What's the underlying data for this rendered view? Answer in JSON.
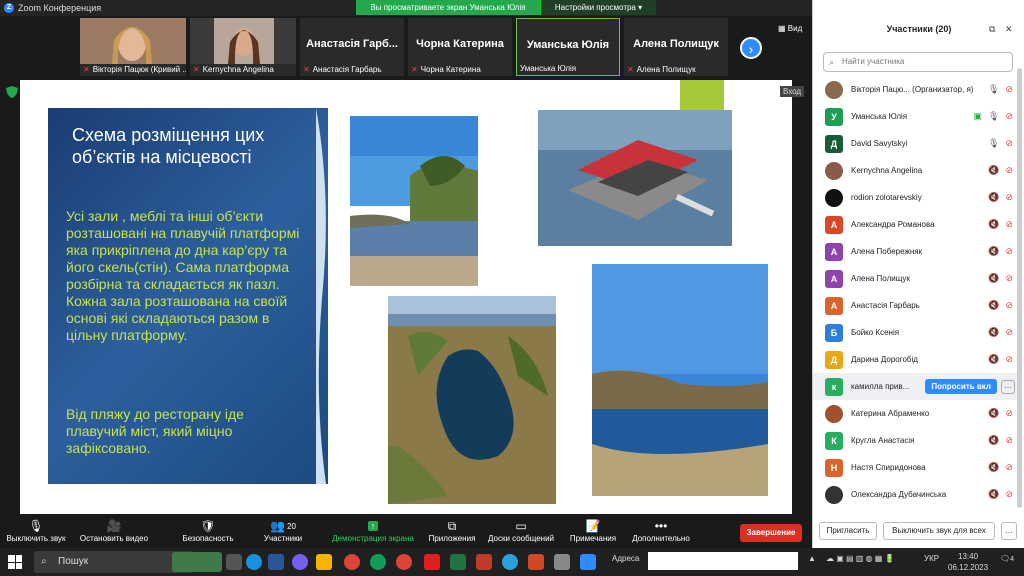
{
  "window": {
    "title": "Zoom Конференция",
    "share_banner": "Вы просматриваете экран Уманська Юлія",
    "view_settings": "Настройки просмотра"
  },
  "thumbnails": [
    {
      "label": "Вікторія Пацюк (Кривий ...",
      "muted": true,
      "video": true
    },
    {
      "label": "Kernychna Angelina",
      "muted": true,
      "video": true
    },
    {
      "name": "Анастасія Гарб...",
      "label": "Анастасія Гарбарь",
      "muted": true
    },
    {
      "name": "Чорна Катерина",
      "label": "Чорна Катерина",
      "muted": true
    },
    {
      "name": "Уманська Юлія",
      "label": "Уманська Юлія",
      "muted": false
    },
    {
      "name": "Алена Полищук",
      "label": "Алена Полищук",
      "muted": true
    }
  ],
  "view_label": "Вид",
  "exit_label": "Вход",
  "slide": {
    "title": "Схема розміщення цих об’єктів на місцевості",
    "body1": "Усі зали , меблі та інші об’єкти розташовані на плавучій платформі яка прикріплена до дна кар’єру та його скель(стін). Сама платформа розбірна та складається  як пазл. Кожна зала розташована на своїй основі які складаються разом в цільну платформу.",
    "body2": "Від пляжу до ресторану іде плавучий міст, який міцно зафіксовано."
  },
  "toolbar": {
    "mute": "Выключить звук",
    "video": "Остановить видео",
    "security": "Безопасность",
    "participants": "Участники",
    "participants_count": "20",
    "share": "Демонстрация экрана",
    "apps": "Приложения",
    "board": "Доски сообщений",
    "notes": "Примечания",
    "more": "Дополнительно",
    "end": "Завершение"
  },
  "panel": {
    "title": "Участники (20)",
    "search_placeholder": "Найти участника",
    "request_btn": "Попросить вкл",
    "invite": "Пригласить",
    "mute_all": "Выключить звук для всех",
    "participants": [
      {
        "name": "Вікторія Пацю... (Организатор, я)",
        "initial": "",
        "color": "#8a6a4a",
        "mic": "on",
        "cam": "off"
      },
      {
        "name": "Уманська Юлія",
        "initial": "У",
        "color": "#1f9d55",
        "mic": "on",
        "cam": "off",
        "sharing": true
      },
      {
        "name": "David Savytskyi",
        "initial": "Д",
        "color": "#1a5c3a",
        "mic": "on",
        "cam": "off"
      },
      {
        "name": "Kernychna Angelina",
        "initial": "",
        "color": "#8a5a4a",
        "mic": "off",
        "cam": "off"
      },
      {
        "name": "rodion zolotarevskiy",
        "initial": "",
        "color": "#111111",
        "mic": "off",
        "cam": "off"
      },
      {
        "name": "Александра Романова",
        "initial": "А",
        "color": "#d9482b",
        "mic": "off",
        "cam": "off"
      },
      {
        "name": "Алена Побережняк",
        "initial": "А",
        "color": "#8e44ad",
        "mic": "off",
        "cam": "off"
      },
      {
        "name": "Алена Полищук",
        "initial": "А",
        "color": "#8e44ad",
        "mic": "off",
        "cam": "off"
      },
      {
        "name": "Анастасія Гарбарь",
        "initial": "А",
        "color": "#d9632b",
        "mic": "off",
        "cam": "off"
      },
      {
        "name": "Бойко Ксенія",
        "initial": "Б",
        "color": "#2d7fd9",
        "mic": "off",
        "cam": "off"
      },
      {
        "name": "Дарина Дорогобід",
        "initial": "Д",
        "color": "#e6a817",
        "mic": "off",
        "cam": "off"
      },
      {
        "name": "камилла прив...",
        "initial": "к",
        "color": "#27ae60",
        "mic": "off",
        "cam": "off",
        "request": true
      },
      {
        "name": "Катерина Абраменко",
        "initial": "",
        "color": "#a0522d",
        "mic": "off",
        "cam": "off"
      },
      {
        "name": "Кругла Анастасія",
        "initial": "К",
        "color": "#27ae60",
        "mic": "off",
        "cam": "off"
      },
      {
        "name": "Настя Спиридонова",
        "initial": "Н",
        "color": "#d9632b",
        "mic": "off",
        "cam": "off"
      },
      {
        "name": "Олександра Дубачинська",
        "initial": "",
        "color": "#333333",
        "mic": "off",
        "cam": "off"
      }
    ]
  },
  "taskbar": {
    "search": "Пошук",
    "address": "Адреса",
    "lang": "УКР",
    "time": "13:40",
    "date": "06.12.2023",
    "notif": "4"
  }
}
